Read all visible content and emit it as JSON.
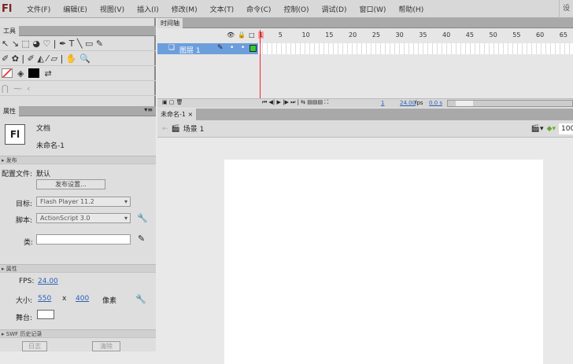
{
  "app": {
    "logo": "Fl",
    "right_label": "设"
  },
  "menu": [
    "文件(F)",
    "编辑(E)",
    "视图(V)",
    "插入(I)",
    "修改(M)",
    "文本(T)",
    "命令(C)",
    "控制(O)",
    "调试(D)",
    "窗口(W)",
    "帮助(H)"
  ],
  "tools": {
    "title": "工具",
    "row1": "↖ ↘ ⬚ ◕ ♡ | ✒ T ╲ ▭ ✎",
    "row2": "✐ ✿ | ✐ ◭ ⁄ ▱ | ✋ 🔍"
  },
  "properties": {
    "title": "属性",
    "doc_type": "文档",
    "doc_name": "未命名-1",
    "icon_text": "Fl",
    "publish": {
      "header": "发布",
      "profile_label": "配置文件:",
      "profile_value": "默认",
      "settings_button": "发布设置...",
      "target_label": "目标:",
      "target_value": "Flash Player 11.2",
      "script_label": "脚本:",
      "script_value": "ActionScript 3.0",
      "class_label": "类:",
      "class_value": ""
    },
    "props": {
      "header": "属性",
      "fps_label": "FPS:",
      "fps_value": "24.00",
      "size_label": "大小:",
      "width": "550",
      "x": "x",
      "height": "400",
      "unit": "像素",
      "stage_label": "舞台:"
    },
    "swf": {
      "header": "SWF 历史记录",
      "log_button": "日志",
      "clear_button": "清除"
    }
  },
  "timeline": {
    "title": "时间轴",
    "layer_name": "图层 1",
    "ruler": [
      "1",
      "5",
      "10",
      "15",
      "20",
      "25",
      "30",
      "35",
      "40",
      "45",
      "50",
      "55",
      "60",
      "65"
    ],
    "current_frame": "1",
    "fps": "24.00",
    "fps_unit": "fps",
    "time": "0.0 s"
  },
  "document": {
    "tab": "未命名-1",
    "close": "×",
    "scene": "场景 1",
    "zoom": "100"
  },
  "colors": {
    "layer_selected": "#6d9edc",
    "playhead": "#e23",
    "stage": "#ffffff"
  }
}
